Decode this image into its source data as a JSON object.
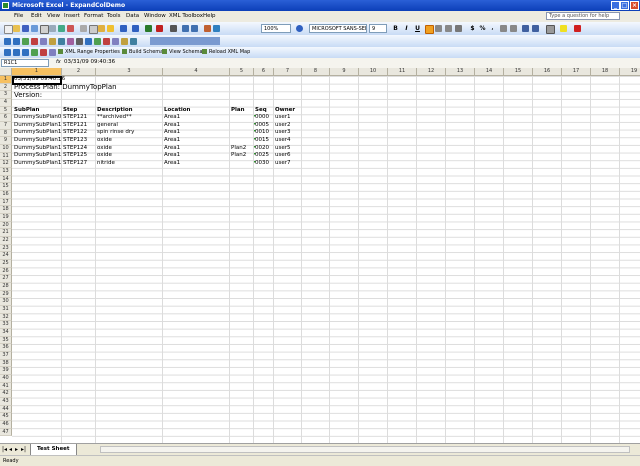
{
  "window": {
    "title": "Microsoft Excel - ExpandColDemo"
  },
  "menu": [
    "File",
    "Edit",
    "View",
    "Insert",
    "Format",
    "Tools",
    "Data",
    "Window",
    "XML Toolbox",
    "Help"
  ],
  "ask_placeholder": "Type a question for help",
  "toolbar": {
    "zoom": "100%",
    "font": "MICROSOFT SANS-SER",
    "size": "9"
  },
  "xml_toolbar": [
    "XML Range Properties",
    "Build Schema",
    "View Schema",
    "Reload XML Map"
  ],
  "formula_bar": {
    "name_box": "R1C1",
    "fx": "fx",
    "value": "03/31/09 09:40:36"
  },
  "columns": [
    "1",
    "2",
    "3",
    "4",
    "5",
    "6",
    "7",
    "8",
    "9",
    "10",
    "11",
    "12",
    "13",
    "14",
    "15",
    "16",
    "17",
    "18",
    "19"
  ],
  "rows_count": 47,
  "cells": {
    "timestamp": "03/31/09 09:40:36",
    "process_plan": "Process Plan: DummyTopPlan",
    "version": "Version:",
    "headers": [
      "SubPlan",
      "Step",
      "Description",
      "Location",
      "Plan",
      "Seq",
      "Owner"
    ],
    "data": [
      [
        "DummySubPlan0",
        "STEP121",
        "**archived**",
        "Area1",
        "",
        "0000",
        "user1"
      ],
      [
        "DummySubPlan1",
        "STEP121",
        "general",
        "Area1",
        "",
        "0005",
        "user2"
      ],
      [
        "DummySubPlan1",
        "STEP122",
        "spin rinse dry",
        "Area1",
        "",
        "0010",
        "user3"
      ],
      [
        "DummySubPlan1",
        "STEP123",
        "oxide",
        "Area1",
        "",
        "0015",
        "user4"
      ],
      [
        "DummySubPlan1",
        "STEP124",
        "oxide",
        "Area1",
        "Plan2",
        "0020",
        "user5"
      ],
      [
        "DummySubPlan1",
        "STEP125",
        "oxide",
        "Area1",
        "Plan2",
        "0025",
        "user6"
      ],
      [
        "DummySubPlan1",
        "STEP127",
        "nitride",
        "Area1",
        "",
        "0030",
        "user7"
      ]
    ]
  },
  "sheet_tab": "Test Sheet",
  "status": "Ready"
}
